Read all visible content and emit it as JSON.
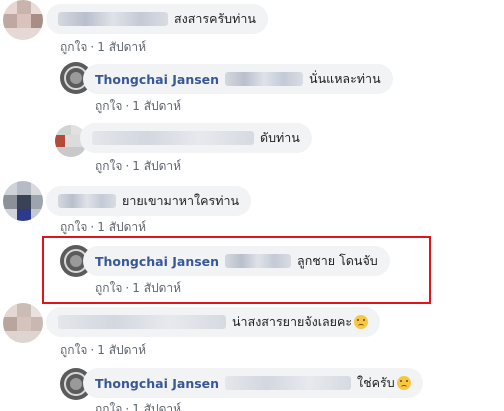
{
  "comments": [
    {
      "blur_w": 110,
      "text": "สงสารครับท่าน",
      "like": "ถูกใจ",
      "time": "1 สัปดาห์"
    },
    {
      "author": "Thongchai Jansen",
      "blur_w": 78,
      "text": "นั่นแหละท่าน",
      "like": "ถูกใจ",
      "time": "1 สัปดาห์"
    },
    {
      "blur_w": 162,
      "text": "ดับท่าน",
      "like": "ถูกใจ",
      "time": "1 สัปดาห์"
    },
    {
      "blur_w": 58,
      "text": "ยายเขามาหาใครท่าน",
      "like": "ถูกใจ",
      "time": "1 สัปดาห์"
    },
    {
      "author": "Thongchai Jansen",
      "blur_w": 66,
      "text": "ลูกชาย โดนจับ",
      "like": "ถูกใจ",
      "time": "1 สัปดาห์"
    },
    {
      "blur_w": 168,
      "text": "น่าสงสารยายจังเลยคะ",
      "like": "ถูกใจ",
      "time": "1 สัปดาห์"
    },
    {
      "author": "Thongchai Jansen",
      "blur_w": 126,
      "text": "ใช่ครับ",
      "like": "ถูกใจ",
      "time": "1 สัปดาห์"
    }
  ],
  "separator": "·",
  "colors": {
    "author": "#385898",
    "bubble": "#f2f3f5",
    "highlight": "#e0151b",
    "meta": "#606770"
  }
}
